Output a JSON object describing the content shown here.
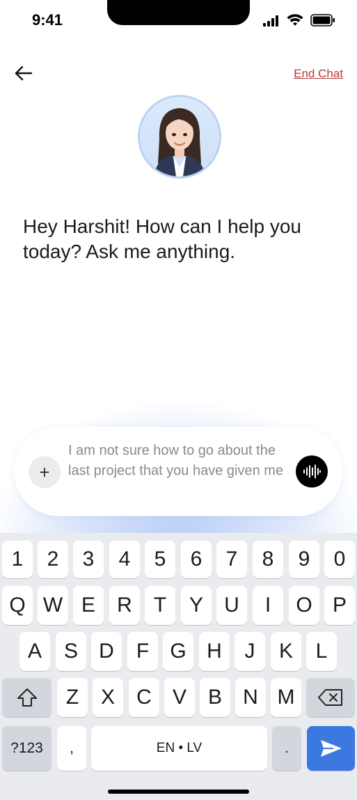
{
  "status": {
    "time": "9:41"
  },
  "header": {
    "end_chat_label": "End Chat"
  },
  "greeting": "Hey Harshit! How can I help you today? Ask me anything.",
  "composer": {
    "plus_label": "+",
    "text": "I am not sure how to go about the last project that you have given me"
  },
  "keyboard": {
    "numbers": [
      "1",
      "2",
      "3",
      "4",
      "5",
      "6",
      "7",
      "8",
      "9",
      "0"
    ],
    "row1": [
      "Q",
      "W",
      "E",
      "R",
      "T",
      "Y",
      "U",
      "I",
      "O",
      "P"
    ],
    "row2": [
      "A",
      "S",
      "D",
      "F",
      "G",
      "H",
      "J",
      "K",
      "L"
    ],
    "row3": [
      "Z",
      "X",
      "C",
      "V",
      "B",
      "N",
      "M"
    ],
    "symbols_label": "?123",
    "comma_label": ",",
    "space_label": "EN • LV",
    "period_label": "."
  },
  "colors": {
    "accent": "#3b78e0",
    "end_chat": "#b43b3b"
  }
}
